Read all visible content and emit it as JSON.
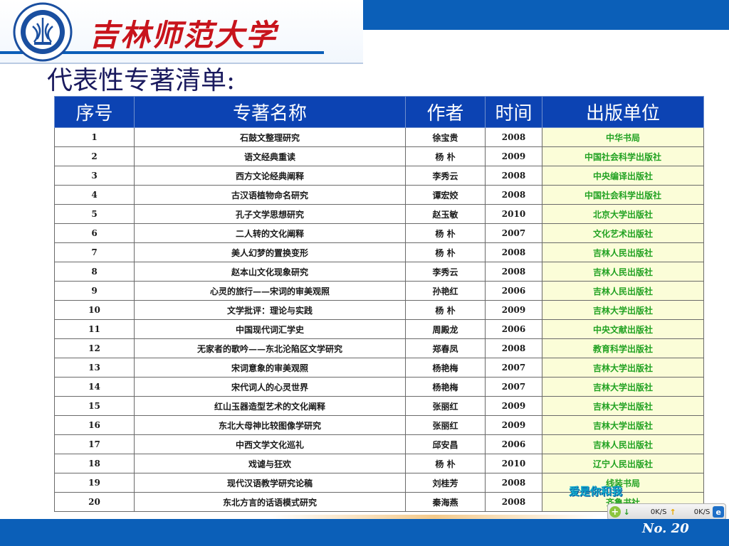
{
  "header": {
    "school_name": "吉林师范大学",
    "page_title": "代表性专著清单:"
  },
  "table": {
    "columns": [
      "序号",
      "专著名称",
      "作者",
      "时间",
      "出版单位"
    ],
    "rows": [
      [
        "1",
        "石鼓文整理研究",
        "徐宝贵",
        "2008",
        "中华书局"
      ],
      [
        "2",
        "语文经典重读",
        "杨 朴",
        "2009",
        "中国社会科学出版社"
      ],
      [
        "3",
        "西方文论经典阐释",
        "李秀云",
        "2008",
        "中央编译出版社"
      ],
      [
        "4",
        "古汉语植物命名研究",
        "谭宏姣",
        "2008",
        "中国社会科学出版社"
      ],
      [
        "5",
        "孔子文学思想研究",
        "赵玉敏",
        "2010",
        "北京大学出版社"
      ],
      [
        "6",
        "二人转的文化阐释",
        "杨 朴",
        "2007",
        "文化艺术出版社"
      ],
      [
        "7",
        "美人幻梦的置换变形",
        "杨 朴",
        "2008",
        "吉林人民出版社"
      ],
      [
        "8",
        "赵本山文化现象研究",
        "李秀云",
        "2008",
        "吉林人民出版社"
      ],
      [
        "9",
        "心灵的旅行——宋词的审美观照",
        "孙艳红",
        "2006",
        "吉林人民出版社"
      ],
      [
        "10",
        "文学批评：理论与实践",
        "杨 朴",
        "2009",
        "吉林大学出版社"
      ],
      [
        "11",
        "中国现代词汇学史",
        "周殿龙",
        "2006",
        "中央文献出版社"
      ],
      [
        "12",
        "无家者的歌吟——东北沦陷区文学研究",
        "郑春凤",
        "2008",
        "教育科学出版社"
      ],
      [
        "13",
        "宋词意象的审美观照",
        "杨艳梅",
        "2007",
        "吉林大学出版社"
      ],
      [
        "14",
        "宋代词人的心灵世界",
        "杨艳梅",
        "2007",
        "吉林大学出版社"
      ],
      [
        "15",
        "红山玉器造型艺术的文化阐释",
        "张丽红",
        "2009",
        "吉林大学出版社"
      ],
      [
        "16",
        "东北大母神比较图像学研究",
        "张丽红",
        "2009",
        "吉林大学出版社"
      ],
      [
        "17",
        "中西文学文化巡礼",
        "邱安昌",
        "2006",
        "吉林人民出版社"
      ],
      [
        "18",
        "戏谑与狂欢",
        "杨 朴",
        "2010",
        "辽宁人民出版社"
      ],
      [
        "19",
        "现代汉语教学研究论稿",
        "刘桂芳",
        "2008",
        "线装书局"
      ],
      [
        "20",
        "东北方言的话语模式研究",
        "秦海燕",
        "2008",
        "齐鲁书社"
      ]
    ]
  },
  "overlay": {
    "text": "爱是你和我"
  },
  "net_meter": {
    "download": "0K/S",
    "upload": "0K/S",
    "plus_symbol": "+",
    "down_symbol": "↓",
    "up_symbol": "↑",
    "ie_symbol": "e"
  },
  "footer": {
    "page_number": "No. 20"
  },
  "colors": {
    "header_blue": "#0b5fb8",
    "table_header": "#0c43b3",
    "school_red": "#c8141c",
    "publisher_green": "#22a222",
    "publisher_bg": "#fbfdd8"
  }
}
